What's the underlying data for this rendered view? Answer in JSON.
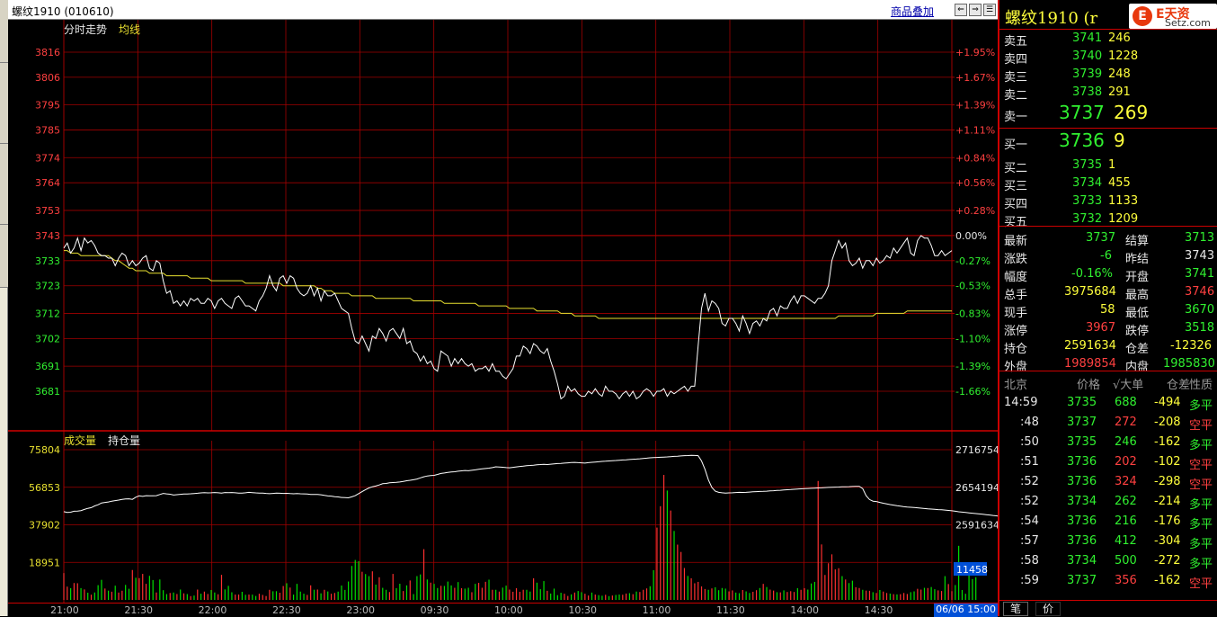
{
  "window": {
    "title": "螺纹1910 (010610)",
    "overlay_label": "商品叠加",
    "btn_labels": [
      "⇐",
      "⇒",
      "☰"
    ]
  },
  "price_panel": {
    "title": "分时走势",
    "avg_label": "均线",
    "y_labels": [
      "3816",
      "3806",
      "3795",
      "3785",
      "3774",
      "3764",
      "3753",
      "3743",
      "3733",
      "3723",
      "3712",
      "3702",
      "3691",
      "3681"
    ],
    "pct_labels": [
      "+1.95%",
      "+1.67%",
      "+1.39%",
      "+1.11%",
      "+0.84%",
      "+0.56%",
      "+0.28%",
      "0.00%",
      "-0.27%",
      "-0.53%",
      "-0.83%",
      "-1.10%",
      "-1.39%",
      "-1.66%"
    ]
  },
  "volume_panel": {
    "label_volume": "成交量",
    "label_oi": "持仓量",
    "y_labels": [
      "75804",
      "56853",
      "37902",
      "18951"
    ],
    "oi_labels": [
      "2716754",
      "2654194",
      "2591634"
    ],
    "current_volume": "11458"
  },
  "x_axis": {
    "labels": [
      "21:00",
      "21:30",
      "22:00",
      "22:30",
      "23:00",
      "09:30",
      "10:00",
      "10:30",
      "11:00",
      "11:30",
      "14:00",
      "14:30"
    ],
    "datetime": "06/06 15:00"
  },
  "chart_data": {
    "type": "line",
    "title": "分时走势",
    "x_ticks": [
      "21:00",
      "21:30",
      "22:00",
      "22:30",
      "23:00",
      "09:30",
      "10:00",
      "10:30",
      "11:00",
      "11:30",
      "14:00",
      "14:30"
    ],
    "ylim": [
      3676,
      3821
    ],
    "prev_close": 3743,
    "price": [
      3738,
      3740,
      3736,
      3738,
      3742,
      3737,
      3742,
      3740,
      3741,
      3739,
      3736,
      3735,
      3735,
      3734,
      3734,
      3731,
      3734,
      3736,
      3735,
      3731,
      3733,
      3731,
      3732,
      3734,
      3735,
      3730,
      3729,
      3733,
      3732,
      3725,
      3720,
      3721,
      3716,
      3717,
      3715,
      3717,
      3715,
      3718,
      3717,
      3718,
      3716,
      3716,
      3718,
      3717,
      3714,
      3717,
      3718,
      3716,
      3715,
      3714,
      3718,
      3719,
      3717,
      3715,
      3715,
      3714,
      3713,
      3717,
      3719,
      3722,
      3727,
      3723,
      3721,
      3726,
      3727,
      3724,
      3727,
      3726,
      3722,
      3720,
      3719,
      3720,
      3723,
      3719,
      3722,
      3717,
      3721,
      3719,
      3719,
      3720,
      3717,
      3714,
      3713,
      3712,
      3706,
      3701,
      3700,
      3703,
      3700,
      3697,
      3703,
      3702,
      3706,
      3704,
      3701,
      3705,
      3706,
      3704,
      3702,
      3706,
      3700,
      3701,
      3697,
      3696,
      3693,
      3695,
      3692,
      3693,
      3690,
      3689,
      3697,
      3696,
      3695,
      3691,
      3694,
      3692,
      3694,
      3692,
      3691,
      3692,
      3689,
      3690,
      3690,
      3691,
      3689,
      3692,
      3689,
      3689,
      3687,
      3686,
      3688,
      3690,
      3695,
      3695,
      3699,
      3698,
      3696,
      3700,
      3699,
      3697,
      3696,
      3698,
      3693,
      3689,
      3684,
      3678,
      3679,
      3683,
      3681,
      3682,
      3680,
      3679,
      3679,
      3681,
      3680,
      3682,
      3680,
      3679,
      3683,
      3681,
      3681,
      3680,
      3678,
      3680,
      3681,
      3679,
      3681,
      3678,
      3679,
      3681,
      3682,
      3681,
      3679,
      3681,
      3681,
      3682,
      3679,
      3681,
      3680,
      3681,
      3682,
      3683,
      3681,
      3683,
      3683,
      3699,
      3714,
      3720,
      3713,
      3717,
      3716,
      3714,
      3708,
      3707,
      3710,
      3710,
      3708,
      3705,
      3711,
      3708,
      3704,
      3708,
      3709,
      3707,
      3710,
      3709,
      3713,
      3714,
      3711,
      3715,
      3714,
      3714,
      3717,
      3719,
      3716,
      3719,
      3719,
      3718,
      3717,
      3716,
      3718,
      3718,
      3720,
      3723,
      3733,
      3737,
      3741,
      3738,
      3740,
      3733,
      3731,
      3732,
      3734,
      3730,
      3733,
      3733,
      3731,
      3734,
      3732,
      3733,
      3735,
      3734,
      3738,
      3736,
      3738,
      3740,
      3742,
      3736,
      3735,
      3741,
      3743,
      3742,
      3742,
      3739,
      3735,
      3735,
      3737,
      3735,
      3736,
      3737
    ],
    "avg": [
      3737,
      3737,
      3736,
      3736,
      3736,
      3735,
      3735,
      3735,
      3735,
      3735,
      3735,
      3735,
      3735,
      3735,
      3734,
      3733,
      3733,
      3732,
      3731,
      3730,
      3730,
      3729,
      3729,
      3729,
      3729,
      3728,
      3728,
      3728,
      3728,
      3728,
      3727,
      3727,
      3727,
      3727,
      3727,
      3727,
      3727,
      3726,
      3726,
      3726,
      3726,
      3726,
      3726,
      3725,
      3725,
      3725,
      3725,
      3725,
      3725,
      3725,
      3725,
      3725,
      3725,
      3724,
      3724,
      3724,
      3724,
      3724,
      3724,
      3724,
      3724,
      3724,
      3724,
      3724,
      3723,
      3723,
      3723,
      3723,
      3723,
      3723,
      3723,
      3723,
      3723,
      3723,
      3722,
      3722,
      3721,
      3721,
      3721,
      3720,
      3720,
      3720,
      3720,
      3720,
      3719,
      3719,
      3719,
      3719,
      3719,
      3719,
      3719,
      3718,
      3718,
      3718,
      3718,
      3718,
      3718,
      3718,
      3718,
      3718,
      3718,
      3718,
      3717,
      3717,
      3717,
      3717,
      3717,
      3717,
      3717,
      3717,
      3717,
      3716,
      3716,
      3716,
      3716,
      3716,
      3716,
      3716,
      3716,
      3716,
      3716,
      3715,
      3715,
      3715,
      3715,
      3715,
      3715,
      3715,
      3715,
      3715,
      3714,
      3714,
      3714,
      3714,
      3714,
      3714,
      3714,
      3714,
      3713,
      3713,
      3713,
      3713,
      3713,
      3713,
      3713,
      3712,
      3712,
      3712,
      3712,
      3711,
      3711,
      3711,
      3711,
      3711,
      3711,
      3711,
      3710,
      3710,
      3710,
      3710,
      3710,
      3710,
      3710,
      3710,
      3710,
      3710,
      3710,
      3710,
      3710,
      3710,
      3710,
      3710,
      3710,
      3710,
      3710,
      3710,
      3710,
      3710,
      3710,
      3710,
      3710,
      3710,
      3710,
      3710,
      3710,
      3710,
      3710,
      3710,
      3710,
      3710,
      3710,
      3710,
      3710,
      3710,
      3710,
      3710,
      3710,
      3710,
      3710,
      3710,
      3710,
      3710,
      3710,
      3710,
      3710,
      3710,
      3710,
      3710,
      3710,
      3710,
      3710,
      3710,
      3710,
      3710,
      3710,
      3710,
      3710,
      3710,
      3710,
      3710,
      3710,
      3710,
      3710,
      3710,
      3710,
      3710,
      3711,
      3711,
      3711,
      3711,
      3711,
      3711,
      3711,
      3711,
      3711,
      3711,
      3711,
      3712,
      3712,
      3712,
      3712,
      3712,
      3712,
      3712,
      3712,
      3712,
      3713,
      3713,
      3713,
      3713,
      3713,
      3713,
      3713,
      3713,
      3713,
      3713,
      3713,
      3713,
      3713,
      3713
    ]
  },
  "volume_chart": {
    "ylim": [
      0,
      75804
    ],
    "oilim": [
      2591634,
      2716754
    ],
    "volume": [
      13542,
      6708,
      5937,
      8515,
      8418,
      5961,
      5287,
      3640,
      2659,
      3751,
      7452,
      10132,
      5744,
      4664,
      4140,
      7180,
      3715,
      4640,
      7580,
      5617,
      15098,
      11186,
      11016,
      13126,
      8113,
      12154,
      10036,
      3751,
      10315,
      4908,
      2949,
      3508,
      3734,
      2985,
      5236,
      3311,
      2966,
      1919,
      2211,
      5225,
      3138,
      4197,
      2993,
      5012,
      3744,
      2852,
      12654,
      5313,
      7101,
      3864,
      2701,
      2706,
      4089,
      2587,
      2709,
      2669,
      1992,
      3125,
      2519,
      1958,
      5108,
      4356,
      4402,
      3637,
      7024,
      8419,
      6231,
      2683,
      8102,
      4201,
      3133,
      2522,
      7356,
      5138,
      5232,
      3316,
      5102,
      4262,
      3109,
      3513,
      4186,
      7256,
      5045,
      9289,
      17135,
      20162,
      19562,
      14213,
      13047,
      12007,
      14432,
      7722,
      11436,
      6101,
      5101,
      3975,
      13120,
      5922,
      8158,
      4474,
      7326,
      9810,
      2939,
      12012,
      12864,
      25604,
      10309,
      8719,
      8108,
      6001,
      7124,
      7050,
      9262,
      7310,
      6113,
      9004,
      5919,
      5706,
      6121,
      3890,
      8115,
      8614,
      6132,
      9132,
      10211,
      5112,
      5115,
      4212,
      6203,
      7211,
      5210,
      4112,
      5908,
      4106,
      5121,
      5102,
      4215,
      10901,
      8706,
      5407,
      9501,
      4600,
      3210,
      5702,
      2402,
      3601,
      3118,
      2002,
      2803,
      3704,
      4502,
      3903,
      3112,
      2214,
      3705,
      2704,
      2406,
      2113,
      2602,
      1913,
      2211,
      2500,
      2716,
      2602,
      3205,
      3413,
      2904,
      4218,
      4002,
      5103,
      5802,
      6902,
      15004,
      36502,
      47303,
      63101,
      55202,
      45104,
      34804,
      27903,
      24205,
      16102,
      12106,
      10907,
      8403,
      9104,
      6803,
      5505,
      5102,
      5806,
      6401,
      4903,
      6002,
      5702,
      4305,
      4801,
      3705,
      3402,
      5003,
      4305,
      3504,
      4103,
      4905,
      6002,
      8103,
      6502,
      5203,
      4705,
      3904,
      3805,
      4806,
      4003,
      4402,
      4003,
      5904,
      5102,
      5903,
      5202,
      8303,
      9102,
      60004,
      28003,
      12605,
      18503,
      23002,
      15404,
      16003,
      12005,
      10304,
      8503,
      9702,
      6405,
      6003,
      5102,
      4703,
      4605,
      3902,
      3504,
      5005,
      4203,
      3504,
      3203,
      2902,
      2802,
      2903,
      3504,
      3003,
      3902,
      4305,
      5602,
      5203,
      6104,
      6005,
      6503,
      5402,
      4805,
      4503,
      12004,
      8006,
      4402,
      7505,
      27303,
      5004,
      3102,
      15604,
      10502,
      11458
    ],
    "oi": [
      2613456,
      2612286,
      2612566,
      2614234,
      2614617,
      2615356,
      2617224,
      2619121,
      2620216,
      2623038,
      2625031,
      2628106,
      2628911,
      2629631,
      2631018,
      2632002,
      2632856,
      2633912,
      2634617,
      2635003,
      2634002,
      2637604,
      2639856,
      2639002,
      2640231,
      2639856,
      2640001,
      2640231,
      2642103,
      2644002,
      2643201,
      2642601,
      2641305,
      2641801,
      2642405,
      2642806,
      2643031,
      2643402,
      2643801,
      2644201,
      2644902,
      2645303,
      2644801,
      2645002,
      2645401,
      2645002,
      2644501,
      2645401,
      2645102,
      2645402,
      2645003,
      2644602,
      2644401,
      2645001,
      2645802,
      2645302,
      2644802,
      2644601,
      2644502,
      2644002,
      2643501,
      2644001,
      2644402,
      2644203,
      2643902,
      2644103,
      2643702,
      2643401,
      2643702,
      2643402,
      2643201,
      2642903,
      2642301,
      2642201,
      2642302,
      2641701,
      2640602,
      2639801,
      2639402,
      2638503,
      2638102,
      2637201,
      2637002,
      2636602,
      2638203,
      2640202,
      2643602,
      2647001,
      2650201,
      2653102,
      2655003,
      2656203,
      2658001,
      2660102,
      2660603,
      2661603,
      2662002,
      2662403,
      2662901,
      2664002,
      2665001,
      2665803,
      2666702,
      2667903,
      2669801,
      2671702,
      2673003,
      2673601,
      2674002,
      2675601,
      2677201,
      2678003,
      2679002,
      2679603,
      2680001,
      2680902,
      2681601,
      2682202,
      2681702,
      2682402,
      2683201,
      2684201,
      2684902,
      2685403,
      2686002,
      2687003,
      2688301,
      2688001,
      2687501,
      2687002,
      2686601,
      2687402,
      2688201,
      2688903,
      2689402,
      2690201,
      2690601,
      2691001,
      2691802,
      2692101,
      2692502,
      2692002,
      2692603,
      2693201,
      2693702,
      2694002,
      2694502,
      2694902,
      2695301,
      2695602,
      2695203,
      2694903,
      2694501,
      2695201,
      2695801,
      2696202,
      2696703,
      2697201,
      2697602,
      2698002,
      2698403,
      2698801,
      2699201,
      2699602,
      2700003,
      2700402,
      2700801,
      2701202,
      2701603,
      2702203,
      2702602,
      2703203,
      2703602,
      2703802,
      2704203,
      2704402,
      2704803,
      2705202,
      2705603,
      2706003,
      2706403,
      2706802,
      2707003,
      2707402,
      2707203,
      2706803,
      2698001,
      2684202,
      2666202,
      2653802,
      2647603,
      2645801,
      2645003,
      2644502,
      2644801,
      2645003,
      2645401,
      2645801,
      2645603,
      2645802,
      2646202,
      2646603,
      2646903,
      2647201,
      2647402,
      2647703,
      2648203,
      2648402,
      2648802,
      2649202,
      2649603,
      2650002,
      2650402,
      2650801,
      2651201,
      2651601,
      2651802,
      2652202,
      2652401,
      2652803,
      2653002,
      2653203,
      2653602,
      2654002,
      2654203,
      2654402,
      2654603,
      2654802,
      2655001,
      2655203,
      2655402,
      2655601,
      2655802,
      2652003,
      2640202,
      2633802,
      2631003,
      2630402,
      2629003,
      2627601,
      2626602,
      2625403,
      2624403,
      2623601,
      2622802,
      2621801,
      2621201,
      2620801,
      2620401,
      2620001,
      2619403,
      2618803,
      2618203,
      2617802,
      2617402,
      2617001,
      2616601,
      2616201,
      2615602,
      2615002,
      2614203,
      2613402,
      2612802,
      2612201,
      2611601,
      2611001,
      2610402,
      2609802,
      2609201,
      2608602,
      2608003,
      2607202,
      2606602,
      2605801,
      2605001,
      2604002,
      2602801,
      2601201,
      2599602,
      2597402,
      2594801,
      2591634
    ]
  },
  "quote": {
    "name": "螺纹1910 (r",
    "logo_text": "E天资",
    "logo_url": "Setz.com",
    "asks": [
      {
        "label": "卖五",
        "price": "3741",
        "vol": "246"
      },
      {
        "label": "卖四",
        "price": "3740",
        "vol": "1228"
      },
      {
        "label": "卖三",
        "price": "3739",
        "vol": "248"
      },
      {
        "label": "卖二",
        "price": "3738",
        "vol": "291"
      },
      {
        "label": "卖一",
        "price": "3737",
        "vol": "269"
      }
    ],
    "bids": [
      {
        "label": "买一",
        "price": "3736",
        "vol": "9"
      },
      {
        "label": "买二",
        "price": "3735",
        "vol": "1"
      },
      {
        "label": "买三",
        "price": "3734",
        "vol": "455"
      },
      {
        "label": "买四",
        "price": "3733",
        "vol": "1133"
      },
      {
        "label": "买五",
        "price": "3732",
        "vol": "1209"
      }
    ],
    "stats": [
      {
        "l1": "最新",
        "v1": "3737",
        "c1": "g",
        "l2": "结算",
        "v2": "3713",
        "c2": "g"
      },
      {
        "l1": "涨跌",
        "v1": "-6",
        "c1": "g",
        "l2": "昨结",
        "v2": "3743",
        "c2": "w"
      },
      {
        "l1": "幅度",
        "v1": "-0.16%",
        "c1": "g",
        "l2": "开盘",
        "v2": "3741",
        "c2": "g"
      },
      {
        "l1": "总手",
        "v1": "3975684",
        "c1": "y",
        "l2": "最高",
        "v2": "3746",
        "c2": "r"
      },
      {
        "l1": "现手",
        "v1": "58",
        "c1": "y",
        "l2": "最低",
        "v2": "3670",
        "c2": "g"
      },
      {
        "l1": "涨停",
        "v1": "3967",
        "c1": "r",
        "l2": "跌停",
        "v2": "3518",
        "c2": "g"
      },
      {
        "l1": "持仓",
        "v1": "2591634",
        "c1": "y",
        "l2": "仓差",
        "v2": "-12326",
        "c2": "y"
      },
      {
        "l1": "外盘",
        "v1": "1989854",
        "c1": "r",
        "l2": "内盘",
        "v2": "1985830",
        "c2": "g"
      }
    ]
  },
  "ticks": {
    "head": {
      "loc": "北京",
      "price": "价格",
      "vol": "√大单",
      "oi": "仓差",
      "nature": "性质"
    },
    "rows": [
      {
        "t": "14:59",
        "p": "3735",
        "pc": "g",
        "v": "688",
        "vc": "g",
        "o": "-494",
        "n": "多平",
        "nc": "g"
      },
      {
        "t": ":48",
        "p": "3737",
        "pc": "g",
        "v": "272",
        "vc": "r",
        "o": "-208",
        "n": "空平",
        "nc": "r"
      },
      {
        "t": ":50",
        "p": "3735",
        "pc": "g",
        "v": "246",
        "vc": "g",
        "o": "-162",
        "n": "多平",
        "nc": "g"
      },
      {
        "t": ":51",
        "p": "3736",
        "pc": "g",
        "v": "202",
        "vc": "r",
        "o": "-102",
        "n": "空平",
        "nc": "r"
      },
      {
        "t": ":52",
        "p": "3736",
        "pc": "g",
        "v": "324",
        "vc": "r",
        "o": "-298",
        "n": "空平",
        "nc": "r"
      },
      {
        "t": ":52",
        "p": "3734",
        "pc": "g",
        "v": "262",
        "vc": "g",
        "o": "-214",
        "n": "多平",
        "nc": "g"
      },
      {
        "t": ":54",
        "p": "3736",
        "pc": "g",
        "v": "216",
        "vc": "g",
        "o": "-176",
        "n": "多平",
        "nc": "g"
      },
      {
        "t": ":57",
        "p": "3736",
        "pc": "g",
        "v": "412",
        "vc": "g",
        "o": "-304",
        "n": "多平",
        "nc": "g"
      },
      {
        "t": ":58",
        "p": "3734",
        "pc": "g",
        "v": "500",
        "vc": "g",
        "o": "-272",
        "n": "多平",
        "nc": "g"
      },
      {
        "t": ":59",
        "p": "3737",
        "pc": "g",
        "v": "356",
        "vc": "r",
        "o": "-162",
        "n": "空平",
        "nc": "r"
      }
    ]
  },
  "bottom_tabs": [
    "笔",
    "价"
  ],
  "colors": {
    "grid": "#a00000",
    "price_line": "#ffffff",
    "avg_line": "#e8e030",
    "vol_up": "#ff3030",
    "vol_down": "#00e000"
  }
}
